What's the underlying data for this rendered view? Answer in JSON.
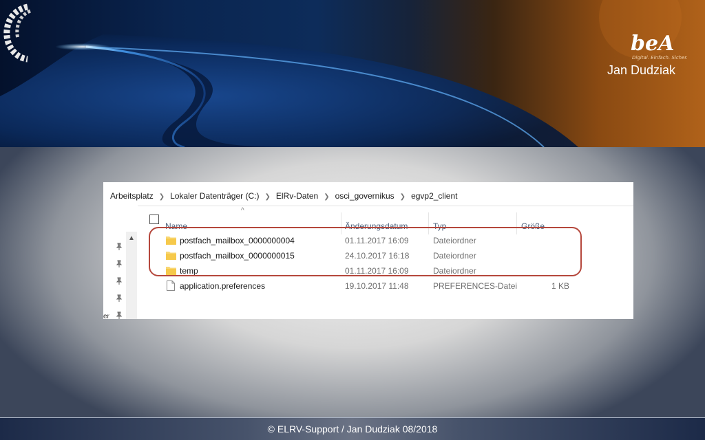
{
  "header": {
    "logo_word": "beA",
    "logo_tagline": "Digital. Einfach. Sicher.",
    "author": "Jan Dudziak"
  },
  "explorer": {
    "breadcrumb": [
      "Arbeitsplatz",
      "Lokaler Datenträger (C:)",
      "ElRv-Daten",
      "osci_governikus",
      "egvp2_client"
    ],
    "columns": {
      "name": "Name",
      "date": "Änderungsdatum",
      "type": "Typ",
      "size": "Größe"
    },
    "nav_cut_text": "er",
    "files": [
      {
        "icon": "folder-icon",
        "name": "postfach_mailbox_0000000004",
        "date": "01.11.2017 16:09",
        "type": "Dateiordner",
        "size": ""
      },
      {
        "icon": "folder-icon",
        "name": "postfach_mailbox_0000000015",
        "date": "24.10.2017 16:18",
        "type": "Dateiordner",
        "size": ""
      },
      {
        "icon": "folder-icon",
        "name": "temp",
        "date": "01.11.2017 16:09",
        "type": "Dateiordner",
        "size": ""
      },
      {
        "icon": "file-icon",
        "name": "application.preferences",
        "date": "19.10.2017 11:48",
        "type": "PREFERENCES-Datei",
        "size": "1 KB"
      }
    ]
  },
  "highlight": {
    "color": "#b5473c"
  },
  "footer": {
    "copyright": "© ELRV-Support / Jan Dudziak 08/2018"
  }
}
